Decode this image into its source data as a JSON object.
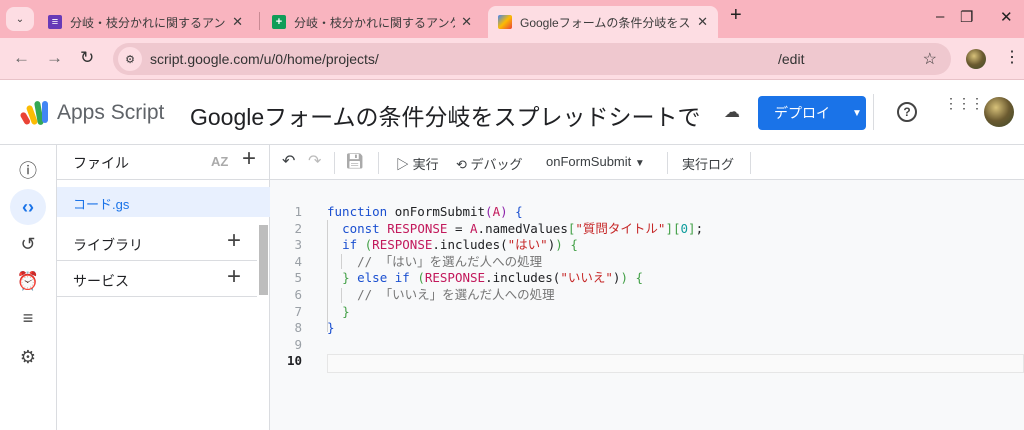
{
  "browser": {
    "tabs": [
      {
        "title": "分岐・枝分かれに関するアンケート -",
        "icon": "forms-icon",
        "color": "#673ab7"
      },
      {
        "title": "分岐・枝分かれに関するアンケート",
        "icon": "sheets-icon",
        "color": "#0f9d58"
      },
      {
        "title": "Googleフォームの条件分岐をスプレ",
        "icon": "apps-script-icon",
        "active": true
      }
    ],
    "url": "script.google.com/u/0/home/projects/",
    "url_suffix": "/edit"
  },
  "header": {
    "app_name": "Apps Script",
    "project_title": "Googleフォームの条件分岐をスプレッドシートで",
    "deploy_label": "デプロイ"
  },
  "files": {
    "title": "ファイル",
    "items": [
      {
        "name": "コード.gs",
        "selected": true
      }
    ],
    "sections": [
      "ライブラリ",
      "サービス"
    ]
  },
  "toolbar": {
    "run": "実行",
    "debug": "デバッグ",
    "function": "onFormSubmit",
    "log": "実行ログ"
  },
  "editor": {
    "current_line": 10,
    "lines": [
      [
        [
          "kw",
          "function "
        ],
        [
          "fn",
          "onFormSubmit"
        ],
        [
          "b3",
          "("
        ],
        [
          "vr",
          "A"
        ],
        [
          "b3",
          ")"
        ],
        [
          "pn",
          " "
        ],
        [
          "b1",
          "{"
        ]
      ],
      [
        [
          "pn",
          "  "
        ],
        [
          "kw",
          "const "
        ],
        [
          "vr",
          "RESPONSE"
        ],
        [
          "pn",
          " = "
        ],
        [
          "vr",
          "A"
        ],
        [
          "pn",
          ".namedValues"
        ],
        [
          "b2",
          "["
        ],
        [
          "st",
          "\"質問タイトル\""
        ],
        [
          "b2",
          "]["
        ],
        [
          "nm",
          "0"
        ],
        [
          "b2",
          "]"
        ],
        [
          "pn",
          ";"
        ]
      ],
      [
        [
          "pn",
          "  "
        ],
        [
          "kw",
          "if "
        ],
        [
          "b2",
          "("
        ],
        [
          "vr",
          "RESPONSE"
        ],
        [
          "pn",
          ".includes("
        ],
        [
          "st",
          "\"はい\""
        ],
        [
          "pn",
          ")"
        ],
        [
          "b2",
          ")"
        ],
        [
          "pn",
          " "
        ],
        [
          "b2",
          "{"
        ]
      ],
      [
        [
          "cm",
          "    // 「はい」を選んだ人への処理"
        ]
      ],
      [
        [
          "pn",
          "  "
        ],
        [
          "b2",
          "}"
        ],
        [
          "kw",
          " else if "
        ],
        [
          "b2",
          "("
        ],
        [
          "vr",
          "RESPONSE"
        ],
        [
          "pn",
          ".includes("
        ],
        [
          "st",
          "\"いいえ\""
        ],
        [
          "pn",
          ")"
        ],
        [
          "b2",
          ")"
        ],
        [
          "pn",
          " "
        ],
        [
          "b2",
          "{"
        ]
      ],
      [
        [
          "cm",
          "    // 「いいえ」を選んだ人への処理"
        ]
      ],
      [
        [
          "pn",
          "  "
        ],
        [
          "b2",
          "}"
        ]
      ],
      [
        [
          "b1",
          "}"
        ]
      ],
      [],
      []
    ]
  }
}
